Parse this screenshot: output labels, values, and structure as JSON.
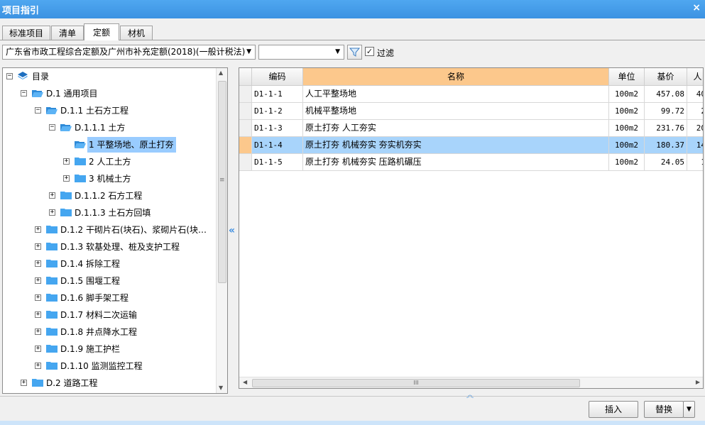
{
  "window": {
    "title": "项目指引",
    "close": "×"
  },
  "tabs": [
    "标准项目",
    "清单",
    "定额",
    "材机"
  ],
  "toolbar": {
    "quota_library": "广东省市政工程综合定额及广州市补充定额(2018)(一般计税法)",
    "secondary_value": "",
    "filter_label": "过滤",
    "filter_checked": "✓"
  },
  "tree": {
    "root": "目录",
    "nodes": [
      {
        "label": "D.1 通用项目",
        "toggle": "−"
      },
      {
        "label": "D.1.1 土石方工程",
        "toggle": "−"
      },
      {
        "label": "D.1.1.1 土方",
        "toggle": "−"
      },
      {
        "label": "1 平整场地、原土打夯",
        "toggle": ""
      },
      {
        "label": "2 人工土方",
        "toggle": "+"
      },
      {
        "label": "3 机械土方",
        "toggle": "+"
      },
      {
        "label": "D.1.1.2 石方工程",
        "toggle": "+"
      },
      {
        "label": "D.1.1.3 土石方回填",
        "toggle": "+"
      },
      {
        "label": "D.1.2 干砌片石(块石)、浆砌片石(块…",
        "toggle": "+"
      },
      {
        "label": "D.1.3 软基处理、桩及支护工程",
        "toggle": "+"
      },
      {
        "label": "D.1.4 拆除工程",
        "toggle": "+"
      },
      {
        "label": "D.1.5 围堰工程",
        "toggle": "+"
      },
      {
        "label": "D.1.6 脚手架工程",
        "toggle": "+"
      },
      {
        "label": "D.1.7 材料二次运输",
        "toggle": "+"
      },
      {
        "label": "D.1.8 井点降水工程",
        "toggle": "+"
      },
      {
        "label": "D.1.9 施工护栏",
        "toggle": "+"
      },
      {
        "label": "D.1.10 监测监控工程",
        "toggle": "+"
      },
      {
        "label": "D.2 道路工程",
        "toggle": "+"
      }
    ]
  },
  "grid": {
    "headers": [
      "编码",
      "名称",
      "单位",
      "基价",
      "人"
    ],
    "rows": [
      {
        "code": "D1-1-1",
        "name": "人工平整场地",
        "unit": "100m2",
        "price": "457.08",
        "labor": "40"
      },
      {
        "code": "D1-1-2",
        "name": "机械平整场地",
        "unit": "100m2",
        "price": "99.72",
        "labor": "2"
      },
      {
        "code": "D1-1-3",
        "name": "原土打夯 人工夯实",
        "unit": "100m2",
        "price": "231.76",
        "labor": "20"
      },
      {
        "code": "D1-1-4",
        "name": "原土打夯 机械夯实 夯实机夯实",
        "unit": "100m2",
        "price": "180.37",
        "labor": "14"
      },
      {
        "code": "D1-1-5",
        "name": "原土打夯 机械夯实 压路机碾压",
        "unit": "100m2",
        "price": "24.05",
        "labor": "1"
      }
    ]
  },
  "scroll": {
    "h_grip": "III",
    "v_grip": "≡"
  },
  "buttons": {
    "insert": "插入",
    "replace": "替换",
    "replace_menu": "▼"
  },
  "colors": {
    "title_bar": "#3c92e2",
    "selection": "#99ccff",
    "name_header": "#fcc88c"
  }
}
